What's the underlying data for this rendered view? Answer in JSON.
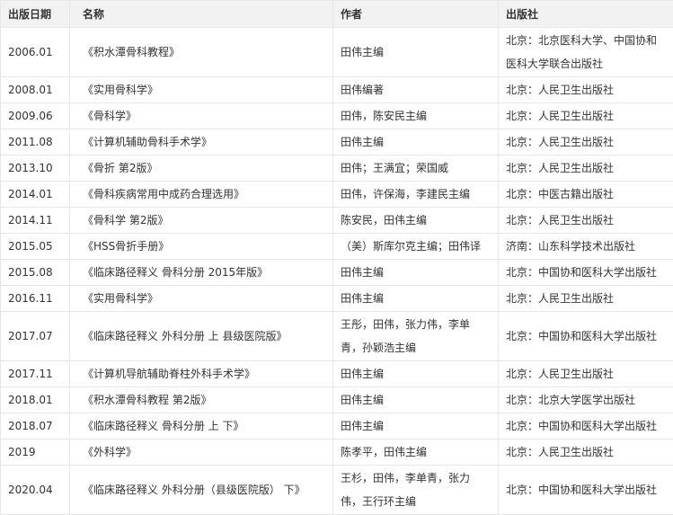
{
  "table": {
    "headers": [
      "出版日期",
      "名称",
      "作者",
      "出版社"
    ],
    "rows": [
      {
        "date": "2006.01",
        "title": "《积水潭骨科教程》",
        "author": "田伟主编",
        "publisher": "北京：北京医科大学、中国协和医科大学联合出版社"
      },
      {
        "date": "2008.01",
        "title": "《实用骨科学》",
        "author": "田伟编著",
        "publisher": "北京：人民卫生出版社"
      },
      {
        "date": "2009.06",
        "title": "《骨科学》",
        "author": "田伟，陈安民主编",
        "publisher": "北京：人民卫生出版社"
      },
      {
        "date": "2011.08",
        "title": "《计算机辅助骨科手术学》",
        "author": "田伟主编",
        "publisher": "北京：人民卫生出版社"
      },
      {
        "date": "2013.10",
        "title": "《骨折 第2版》",
        "author": "田伟；王满宜；荣国威",
        "publisher": "北京：人民卫生出版社"
      },
      {
        "date": "2014.01",
        "title": "《骨科疾病常用中成药合理选用》",
        "author": "田伟，许保海，李建民主编",
        "publisher": "北京：中医古籍出版社"
      },
      {
        "date": "2014.11",
        "title": "《骨科学 第2版》",
        "author": "陈安民，田伟主编",
        "publisher": "北京：人民卫生出版社"
      },
      {
        "date": "2015.05",
        "title": "《HSS骨折手册》",
        "author": "（美）斯库尔克主编；田伟译",
        "publisher": "济南：山东科学技术出版社"
      },
      {
        "date": "2015.08",
        "title": "《临床路径释义 骨科分册 2015年版》",
        "author": "田伟主编",
        "publisher": "北京：中国协和医科大学出版社"
      },
      {
        "date": "2016.11",
        "title": "《实用骨科学》",
        "author": "田伟主编",
        "publisher": "北京：人民卫生出版社"
      },
      {
        "date": "2017.07",
        "title": "《临床路径释义 外科分册 上 县级医院版》",
        "author": "王彤，田伟，张力伟，李单青，孙颖浩主编",
        "publisher": "北京：中国协和医科大学出版社"
      },
      {
        "date": "2017.11",
        "title": "《计算机导航辅助脊柱外科手术学》",
        "author": "田伟主编",
        "publisher": "北京：人民卫生出版社"
      },
      {
        "date": "2018.01",
        "title": "《积水潭骨科教程 第2版》",
        "author": "田伟主编",
        "publisher": "北京：北京大学医学出版社"
      },
      {
        "date": "2018.07",
        "title": "《临床路径释义 骨科分册 上 下》",
        "author": "田伟主编",
        "publisher": "北京：中国协和医科大学出版社"
      },
      {
        "date": "2019",
        "title": "《外科学》",
        "author": "陈孝平，田伟主编",
        "publisher": "北京：人民卫生出版社"
      },
      {
        "date": "2020.04",
        "title": "《临床路径释义 外科分册（县级医院版） 下》",
        "author": "王杉，田伟，李单青，张力伟，王行环主编",
        "publisher": "北京：中国协和医科大学出版社"
      }
    ]
  }
}
